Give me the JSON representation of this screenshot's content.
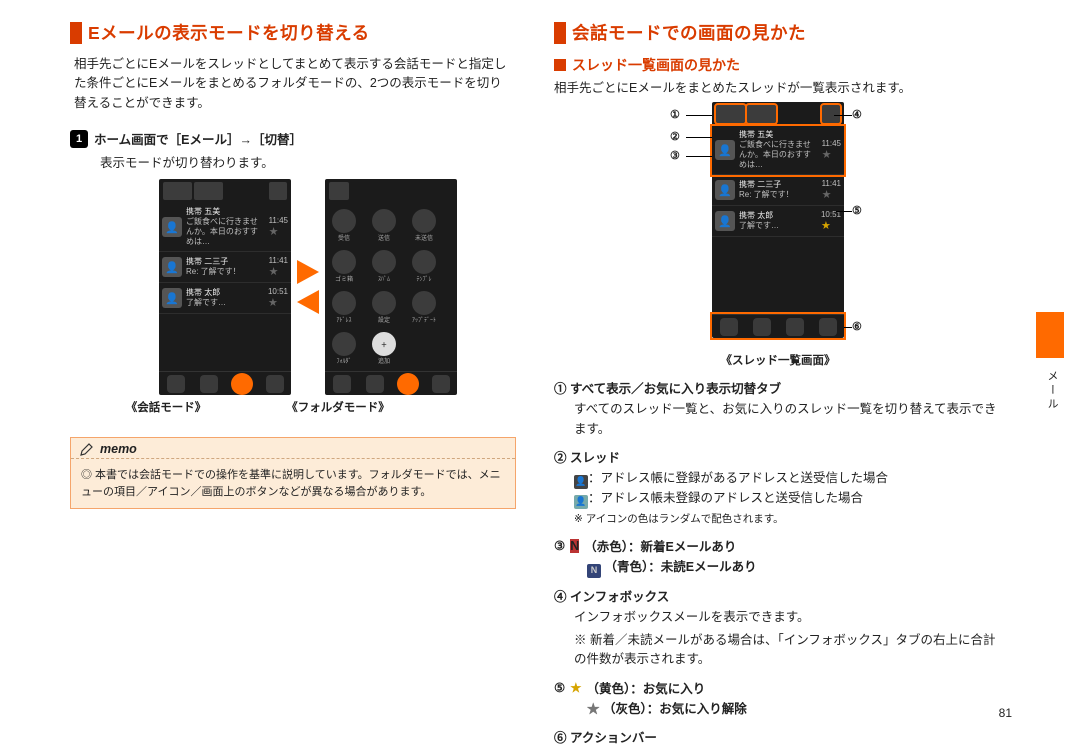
{
  "page_number": "81",
  "side_tab_label": "メール",
  "left": {
    "h1": "Eメールの表示モードを切り替える",
    "intro": "相手先ごとにEメールをスレッドとしてまとめて表示する会話モードと指定した条件ごとにEメールをまとめるフォルダモードの、2つの表示モードを切り替えることができます。",
    "step_num": "1",
    "step_label": "ホーム画面で［Eメール］→［切替］",
    "step_sub": "表示モードが切り替わります。",
    "caption_left": "《会話モード》",
    "caption_right": "《フォルダモード》",
    "memo_label": "memo",
    "memo_body": "◎ 本書では会話モードでの操作を基準に説明しています。フォルダモードでは、メニューの項目／アイコン／画面上のボタンなどが異なる場合があります。",
    "threads": [
      {
        "name": "携帯 五美",
        "preview": "ご飯食べに行きませんか。本日のおすすめは…",
        "time": "11:45"
      },
      {
        "name": "携帯 二三子",
        "preview": "Re: 了解です！",
        "time": "11:41"
      },
      {
        "name": "携帯 太郎",
        "preview": "了解です…",
        "time": "10:51"
      }
    ],
    "folder_icons": [
      "受信",
      "送信",
      "未送信",
      "ゴミ箱",
      "ｽﾊﾟﾑ",
      "ﾃﾝﾌﾟﾚ",
      "ｱﾄﾞﾚｽ",
      "設定",
      "ｱｯﾌﾟﾃﾞｰﾄ",
      "ﾌｫﾙﾀﾞ",
      "追加"
    ]
  },
  "right": {
    "h1": "会話モードでの画面の見かた",
    "h2": "スレッド一覧画面の見かた",
    "intro": "相手先ごとにEメールをまとめたスレッドが一覧表示されます。",
    "diagram_caption": "《スレッド一覧画面》",
    "callouts": {
      "c1": "①",
      "c2": "②",
      "c3": "③",
      "c4": "④",
      "c5": "⑤",
      "c6": "⑥"
    },
    "items": {
      "1": {
        "hd": "① すべて表示／お気に入り表示切替タブ",
        "body": "すべてのスレッド一覧と、お気に入りのスレッド一覧を切り替えて表示できます。"
      },
      "2": {
        "hd": "② スレッド",
        "line_a": "：アドレス帳に登録があるアドレスと送受信した場合",
        "line_b": "：アドレス帳未登録のアドレスと送受信した場合",
        "note": "※ アイコンの色はランダムで配色されます。"
      },
      "3": {
        "hd": "③",
        "red": "（赤色）：新着Eメールあり",
        "blue": "（青色）：未読Eメールあり",
        "icon_label": "N"
      },
      "4": {
        "hd": "④ インフォボックス",
        "body": "インフォボックスメールを表示できます。",
        "note": "※ 新着／未読メールがある場合は、「インフォボックス」タブの右上に合計の件数が表示されます。"
      },
      "5": {
        "hd": "⑤",
        "yellow": "（黄色）：お気に入り",
        "gray": "（灰色）：お気に入り解除"
      },
      "6": {
        "hd": "⑥ アクションバー"
      }
    }
  }
}
